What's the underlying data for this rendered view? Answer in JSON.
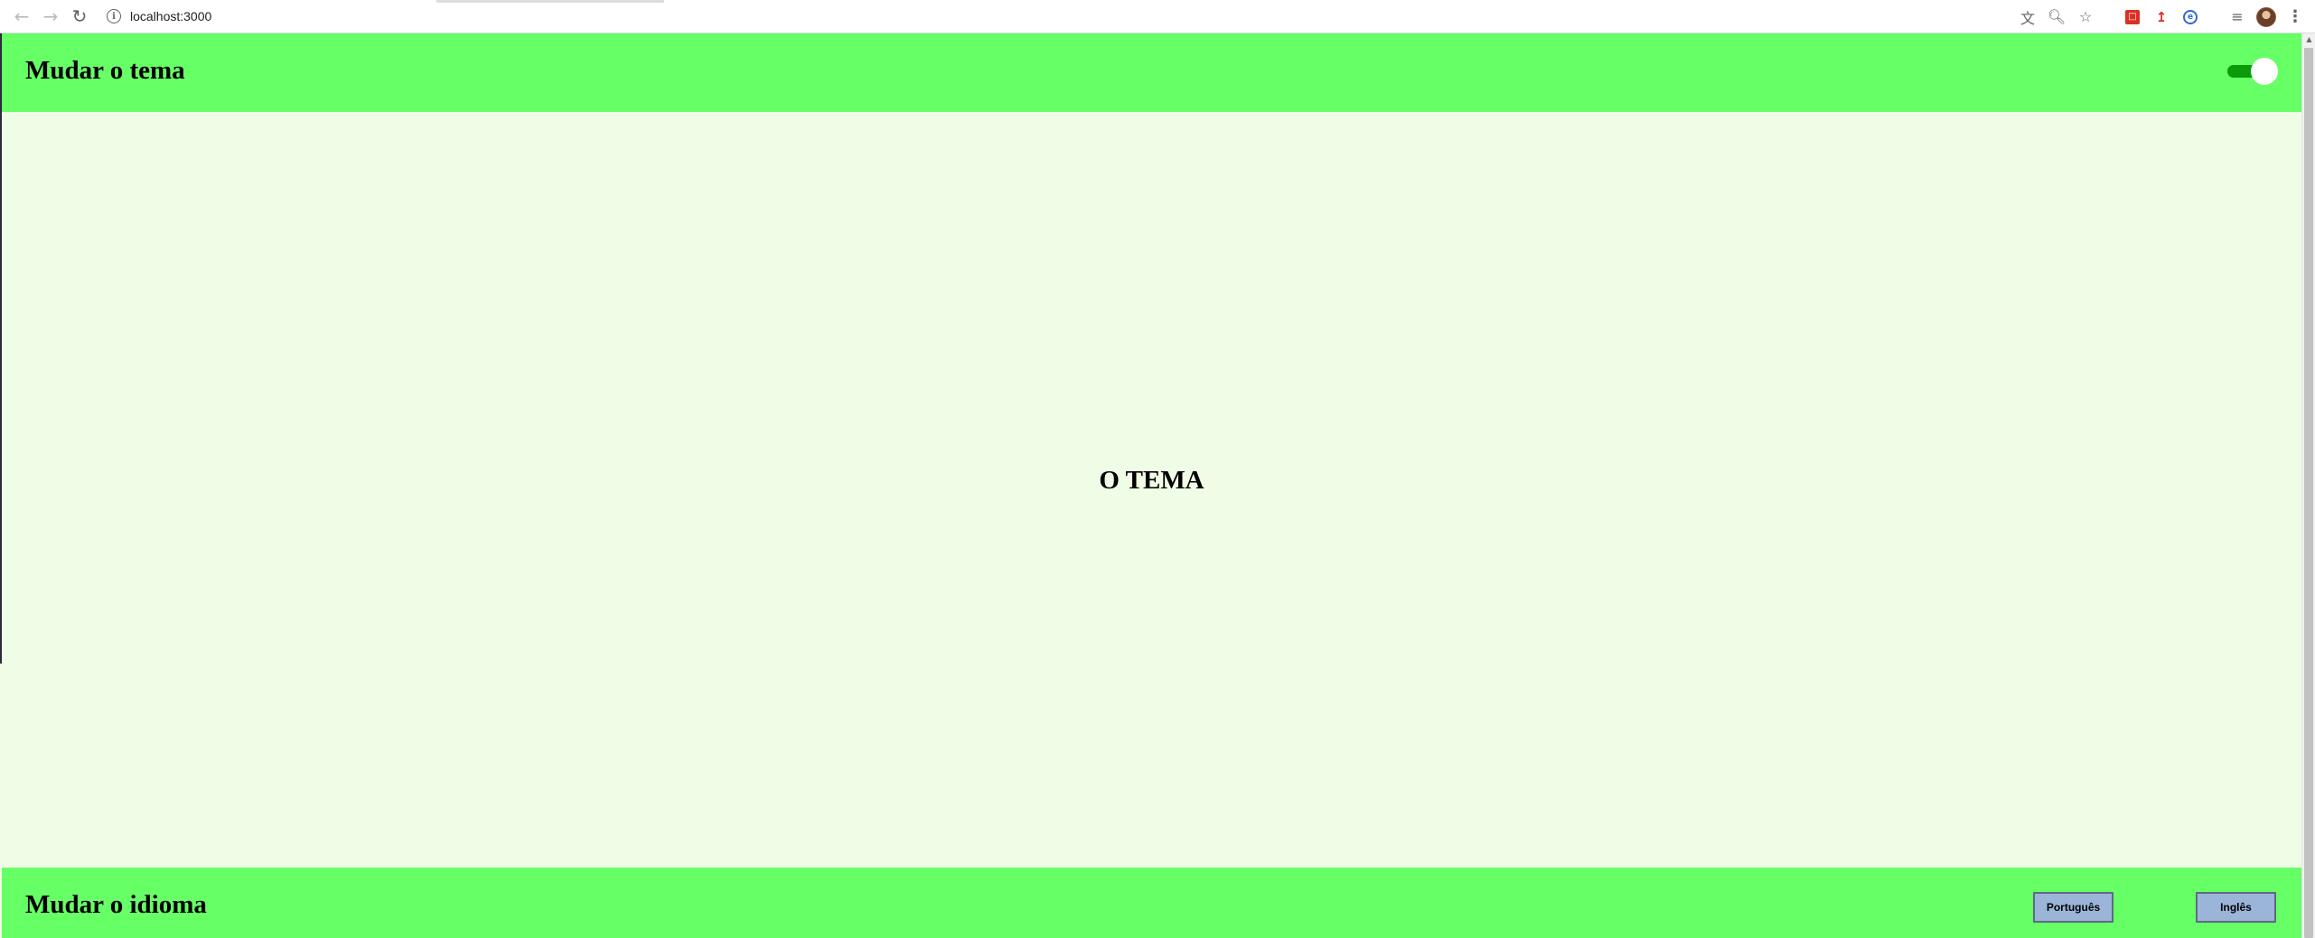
{
  "browser": {
    "url": "localhost:3000",
    "icons": {
      "back": "arrow-left-icon",
      "forward": "arrow-right-icon",
      "reload": "reload-icon",
      "site_info": "info-icon",
      "translate": "translate-icon",
      "zoom": "zoom-icon",
      "bookmark": "star-icon",
      "extensions": [
        "red-extension-icon",
        "red-tool-extension-icon",
        "blue-extension-icon"
      ],
      "media": "media-control-icon",
      "profile": "avatar",
      "menu": "more-vertical-icon"
    }
  },
  "page": {
    "header": {
      "title": "Mudar o tema",
      "theme_toggle_on": true
    },
    "main": {
      "text": "O TEMA"
    },
    "footer": {
      "title": "Mudar o idioma",
      "buttons": {
        "portuguese": "Português",
        "english": "Inglês"
      }
    },
    "colors": {
      "header_bg": "#66ff66",
      "page_bg": "#f0fde6",
      "toggle_track": "#0a9a0a",
      "button_bg": "#9bb5d9"
    }
  }
}
